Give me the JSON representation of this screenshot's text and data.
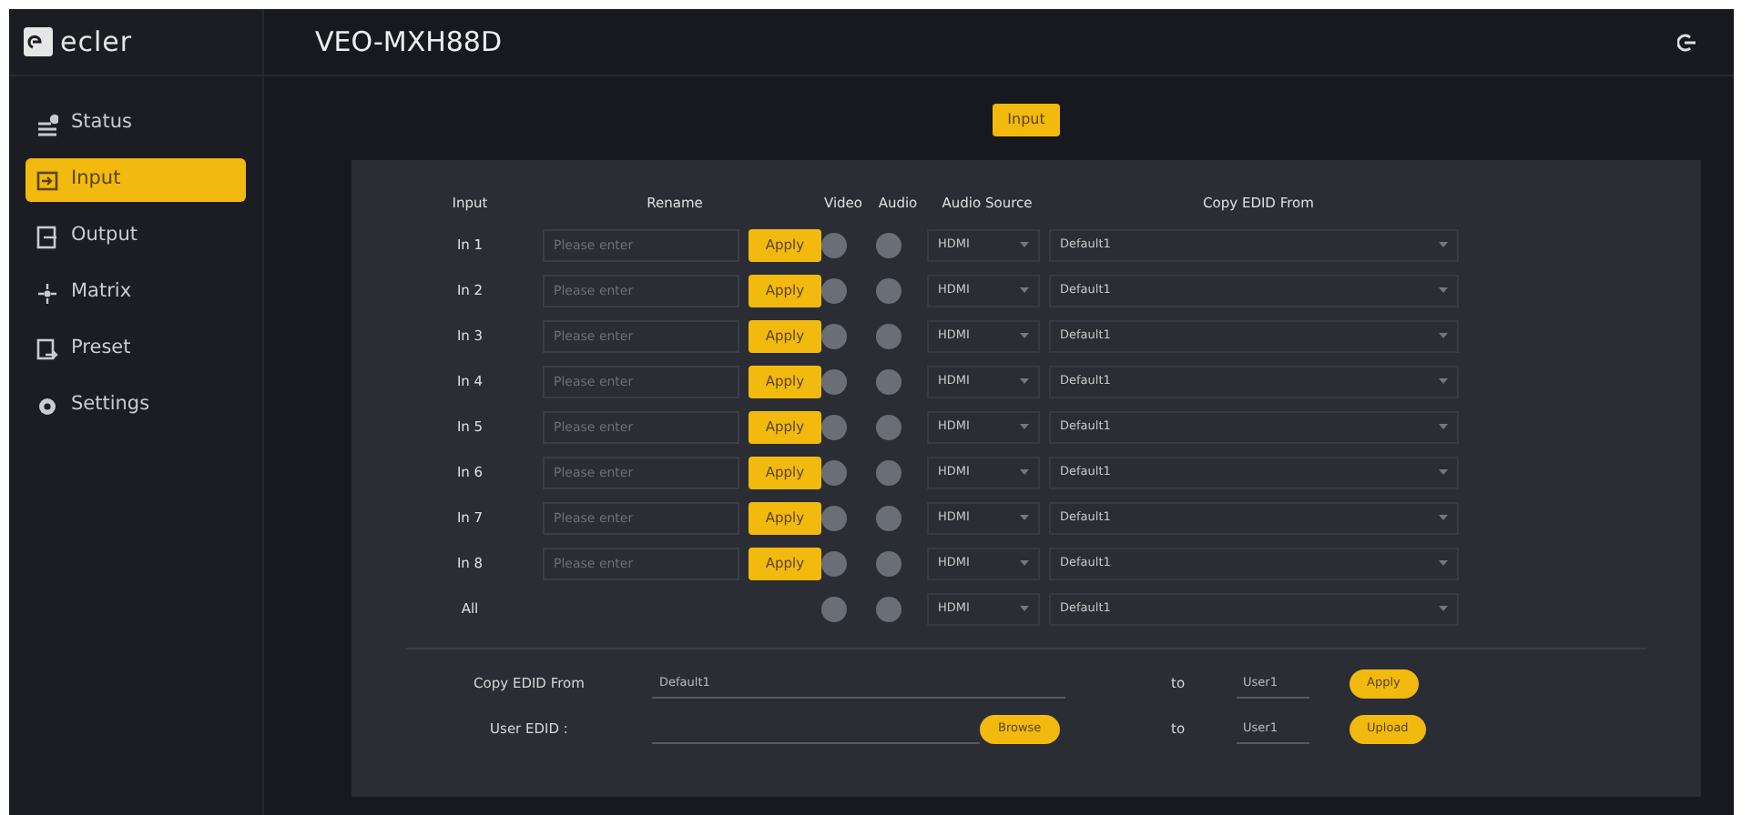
{
  "app": {
    "logo": "ecler",
    "title": "VEO-MXH88D"
  },
  "sidebar": {
    "items": [
      {
        "label": "Status",
        "kind": "status",
        "selected": false
      },
      {
        "label": "Input",
        "kind": "input",
        "selected": true
      },
      {
        "label": "Output",
        "kind": "output",
        "selected": false
      },
      {
        "label": "Matrix",
        "kind": "matrix",
        "selected": false
      },
      {
        "label": "Preset",
        "kind": "preset",
        "selected": false
      },
      {
        "label": "Settings",
        "kind": "settings",
        "selected": false
      }
    ]
  },
  "page_tag": "Input",
  "table": {
    "columns": [
      "Input",
      "Rename",
      "Video",
      "Audio",
      "Audio Source",
      "Copy EDID From"
    ],
    "rows": [
      {
        "input": "In 1",
        "placeholder": "Please enter",
        "apply": "Apply",
        "video": false,
        "audio": false,
        "audio_source": "HDMI",
        "copy_edid": "Default1"
      },
      {
        "input": "In 2",
        "placeholder": "Please enter",
        "apply": "Apply",
        "video": false,
        "audio": false,
        "audio_source": "HDMI",
        "copy_edid": "Default1"
      },
      {
        "input": "In 3",
        "placeholder": "Please enter",
        "apply": "Apply",
        "video": false,
        "audio": false,
        "audio_source": "HDMI",
        "copy_edid": "Default1"
      },
      {
        "input": "In 4",
        "placeholder": "Please enter",
        "apply": "Apply",
        "video": false,
        "audio": false,
        "audio_source": "HDMI",
        "copy_edid": "Default1"
      },
      {
        "input": "In 5",
        "placeholder": "Please enter",
        "apply": "Apply",
        "video": false,
        "audio": false,
        "audio_source": "HDMI",
        "copy_edid": "Default1"
      },
      {
        "input": "In 6",
        "placeholder": "Please enter",
        "apply": "Apply",
        "video": false,
        "audio": false,
        "audio_source": "HDMI",
        "copy_edid": "Default1"
      },
      {
        "input": "In 7",
        "placeholder": "Please enter",
        "apply": "Apply",
        "video": false,
        "audio": false,
        "audio_source": "HDMI",
        "copy_edid": "Default1"
      },
      {
        "input": "In 8",
        "placeholder": "Please enter",
        "apply": "Apply",
        "video": false,
        "audio": false,
        "audio_source": "HDMI",
        "copy_edid": "Default1"
      },
      {
        "input": "All",
        "video": false,
        "audio": false,
        "audio_source": "HDMI",
        "copy_edid": "Default1"
      }
    ]
  },
  "copy_edid": {
    "label": "Copy EDID From",
    "source": "Default1",
    "to": "to",
    "target": "User1",
    "button": "Apply"
  },
  "user_edid": {
    "label": "User EDID :",
    "browse": "Browse",
    "to": "to",
    "target": "User1",
    "button": "Upload"
  }
}
